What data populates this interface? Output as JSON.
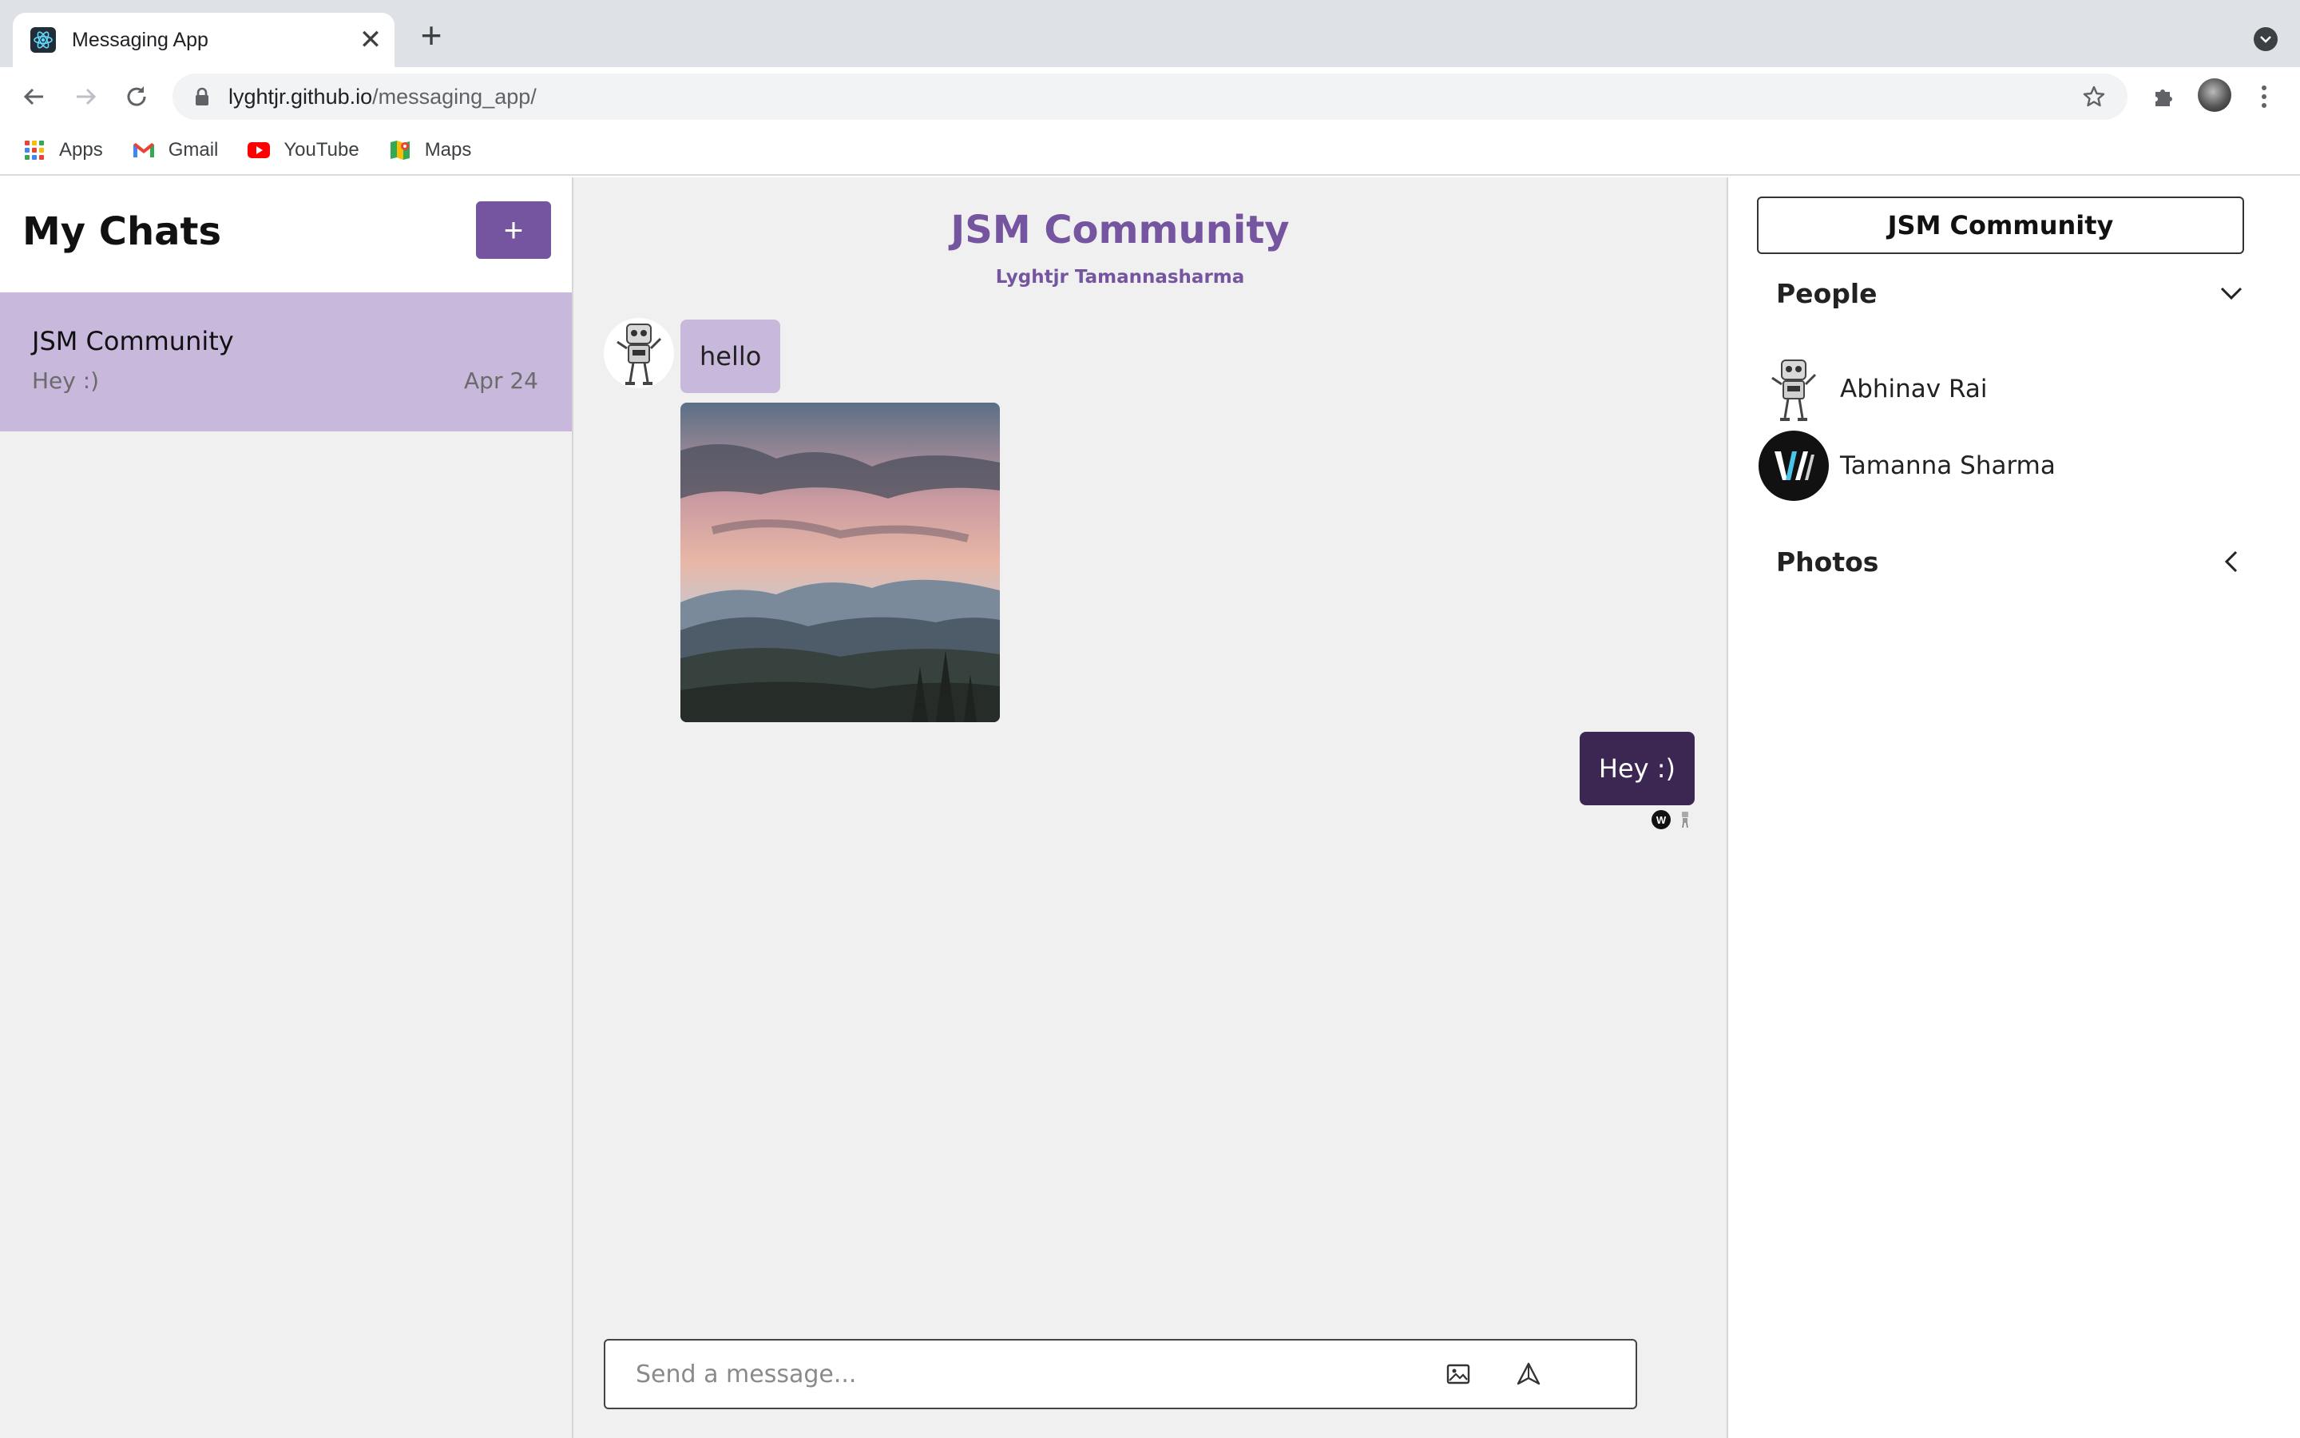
{
  "browser": {
    "tab_title": "Messaging App",
    "tab_close": "✕",
    "new_tab": "+",
    "url_host": "lyghtjr.github.io",
    "url_path": "/messaging_app/",
    "bookmarks": [
      {
        "label": "Apps",
        "icon": "apps-grid-icon"
      },
      {
        "label": "Gmail",
        "icon": "gmail-icon"
      },
      {
        "label": "YouTube",
        "icon": "youtube-icon"
      },
      {
        "label": "Maps",
        "icon": "maps-icon"
      }
    ]
  },
  "chat_list": {
    "title": "My Chats",
    "new_chat_label": "+",
    "chats": [
      {
        "title": "JSM Community",
        "last_message": "Hey :)",
        "date": "Apr 24",
        "active": true
      }
    ]
  },
  "chat_feed": {
    "title": "JSM Community",
    "subtitle": "Lyghtjr Tamannasharma",
    "messages": [
      {
        "direction": "incoming",
        "type": "text",
        "text": "hello",
        "sender_avatar": "robot-avatar"
      },
      {
        "direction": "incoming",
        "type": "image",
        "alt": "mountain-sunset-photo"
      },
      {
        "direction": "outgoing",
        "type": "text",
        "text": "Hey :)"
      }
    ],
    "read_receipts": [
      "W",
      "robot"
    ],
    "composer": {
      "placeholder": "Send a message...",
      "value": ""
    }
  },
  "settings": {
    "title": "JSM Community",
    "people_label": "People",
    "photos_label": "Photos",
    "people": [
      {
        "name": "Abhinav Rai",
        "avatar": "robot-avatar",
        "online": true
      },
      {
        "name": "Tamanna Sharma",
        "avatar": "w-logo-avatar",
        "online": true
      }
    ]
  },
  "colors": {
    "accent": "#7554a0",
    "active_chat": "#c7b8dc",
    "outgoing_bubble": "#3b2751",
    "background": "#f0f0f0"
  }
}
